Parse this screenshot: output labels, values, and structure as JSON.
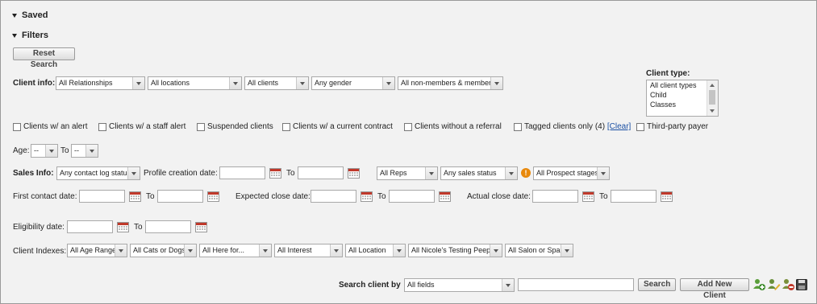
{
  "sections": {
    "saved": "Saved",
    "filters": "Filters"
  },
  "reset_button": "Reset Search",
  "client_info": {
    "label": "Client info:",
    "selects": [
      "All Relationships",
      "All locations",
      "All clients",
      "Any gender",
      "All non-members & members"
    ]
  },
  "client_type": {
    "label": "Client type:",
    "options": [
      "All client types",
      "Child",
      "Classes"
    ]
  },
  "checkboxes": {
    "alert": "Clients w/ an alert",
    "staff_alert": "Clients w/ a staff alert",
    "suspended": "Suspended clients",
    "contract": "Clients w/ a current contract",
    "no_referral": "Clients without a referral",
    "tagged": "Tagged clients only (4)",
    "clear": "[Clear]",
    "third_party": "Third-party payer"
  },
  "age": {
    "label": "Age:",
    "from": "--",
    "to_label": "To",
    "to": "--"
  },
  "sales_info": {
    "label": "Sales Info:",
    "contact_log": "Any contact log status",
    "profile_date_label": "Profile creation date:",
    "to_label": "To",
    "reps": "All Reps",
    "sales_status": "Any sales status",
    "warning": "!",
    "prospect": "All Prospect stages"
  },
  "dates": {
    "first_contact": "First contact date:",
    "expected_close": "Expected close date:",
    "actual_close": "Actual close date:",
    "eligibility": "Eligibility date:",
    "to": "To"
  },
  "client_indexes": {
    "label": "Client Indexes:",
    "selects": [
      "All Age Range",
      "All Cats or Dogs",
      "All Here for...",
      "All Interest",
      "All Location",
      "All Nicole's Testing Peeps",
      "All Salon or Spa?"
    ]
  },
  "search": {
    "label": "Search client by",
    "field": "All fields",
    "query": "",
    "search_button": "Search",
    "add_button": "Add New Client"
  },
  "colors": {
    "link": "#1a4fa3",
    "warning": "#e8890c",
    "calendar": "#c0392b"
  }
}
